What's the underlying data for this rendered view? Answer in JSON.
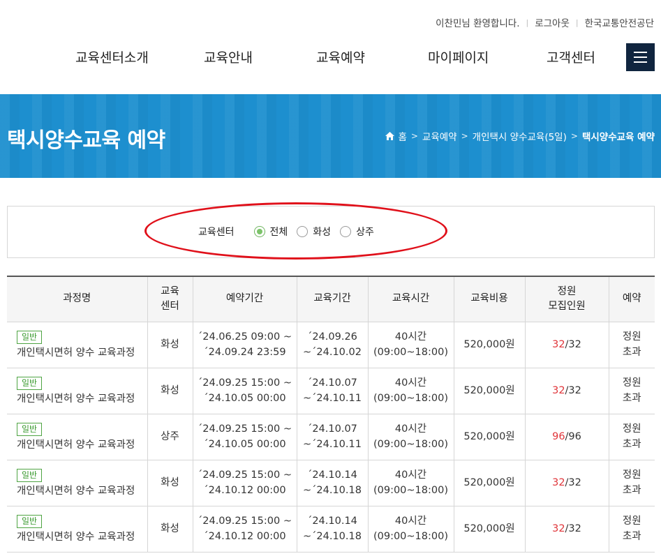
{
  "util": {
    "greeting": "이찬민님 환영합니다.",
    "logout": "로그아웃",
    "org": "한국교통안전공단"
  },
  "nav": {
    "items": [
      "교육센터소개",
      "교육안내",
      "교육예약",
      "마이페이지",
      "고객센터"
    ]
  },
  "banner": {
    "title": "택시양수교육 예약",
    "breadcrumb": [
      "홈",
      "교육예약",
      "개인택시 양수교육(5일)",
      "택시양수교육 예약"
    ]
  },
  "filter": {
    "label": "교육센터",
    "options": [
      "전체",
      "화성",
      "상주"
    ],
    "selected": "전체"
  },
  "table": {
    "headers": {
      "course": "과정명",
      "center_1": "교육",
      "center_2": "센터",
      "reserve_period": "예약기간",
      "edu_period": "교육기간",
      "edu_time": "교육시간",
      "fee": "교육비용",
      "cap_1": "정원",
      "cap_2": "모집인원",
      "reserve": "예약"
    },
    "rows": [
      {
        "badge": "일반",
        "name": "개인택시면허 양수 교육과정",
        "center": "화성",
        "rsv1": "´24.06.25 09:00 ~",
        "rsv2": "´24.09.24 23:59",
        "edu1": "´24.09.26",
        "edu2": "~´24.10.02",
        "time1": "40시간",
        "time2": "(09:00~18:00)",
        "fee": "520,000원",
        "recruited": "32",
        "capacity": "/32",
        "st1": "정원",
        "st2": "초과"
      },
      {
        "badge": "일반",
        "name": "개인택시면허 양수 교육과정",
        "center": "화성",
        "rsv1": "´24.09.25 15:00 ~",
        "rsv2": "´24.10.05 00:00",
        "edu1": "´24.10.07",
        "edu2": "~´24.10.11",
        "time1": "40시간",
        "time2": "(09:00~18:00)",
        "fee": "520,000원",
        "recruited": "32",
        "capacity": "/32",
        "st1": "정원",
        "st2": "초과"
      },
      {
        "badge": "일반",
        "name": "개인택시면허 양수 교육과정",
        "center": "상주",
        "rsv1": "´24.09.25 15:00 ~",
        "rsv2": "´24.10.05 00:00",
        "edu1": "´24.10.07",
        "edu2": "~´24.10.11",
        "time1": "40시간",
        "time2": "(09:00~18:00)",
        "fee": "520,000원",
        "recruited": "96",
        "capacity": "/96",
        "st1": "정원",
        "st2": "초과"
      },
      {
        "badge": "일반",
        "name": "개인택시면허 양수 교육과정",
        "center": "화성",
        "rsv1": "´24.09.25 15:00 ~",
        "rsv2": "´24.10.12 00:00",
        "edu1": "´24.10.14",
        "edu2": "~´24.10.18",
        "time1": "40시간",
        "time2": "(09:00~18:00)",
        "fee": "520,000원",
        "recruited": "32",
        "capacity": "/32",
        "st1": "정원",
        "st2": "초과"
      },
      {
        "badge": "일반",
        "name": "개인택시면허 양수 교육과정",
        "center": "화성",
        "rsv1": "´24.09.25 15:00 ~",
        "rsv2": "´24.10.12 00:00",
        "edu1": "´24.10.14",
        "edu2": "~´24.10.18",
        "time1": "40시간",
        "time2": "(09:00~18:00)",
        "fee": "520,000원",
        "recruited": "32",
        "capacity": "/32",
        "st1": "정원",
        "st2": "초과"
      }
    ]
  },
  "colors": {
    "banner": "#1d8fcf",
    "menu_button": "#10253f",
    "badge_green": "#3a9a2f",
    "recruited_red": "#e0353a",
    "annotation_ellipse": "#e0101a"
  },
  "icons": [
    "home-icon",
    "chevron-right-icon",
    "hamburger-menu-icon",
    "radio-icon"
  ]
}
